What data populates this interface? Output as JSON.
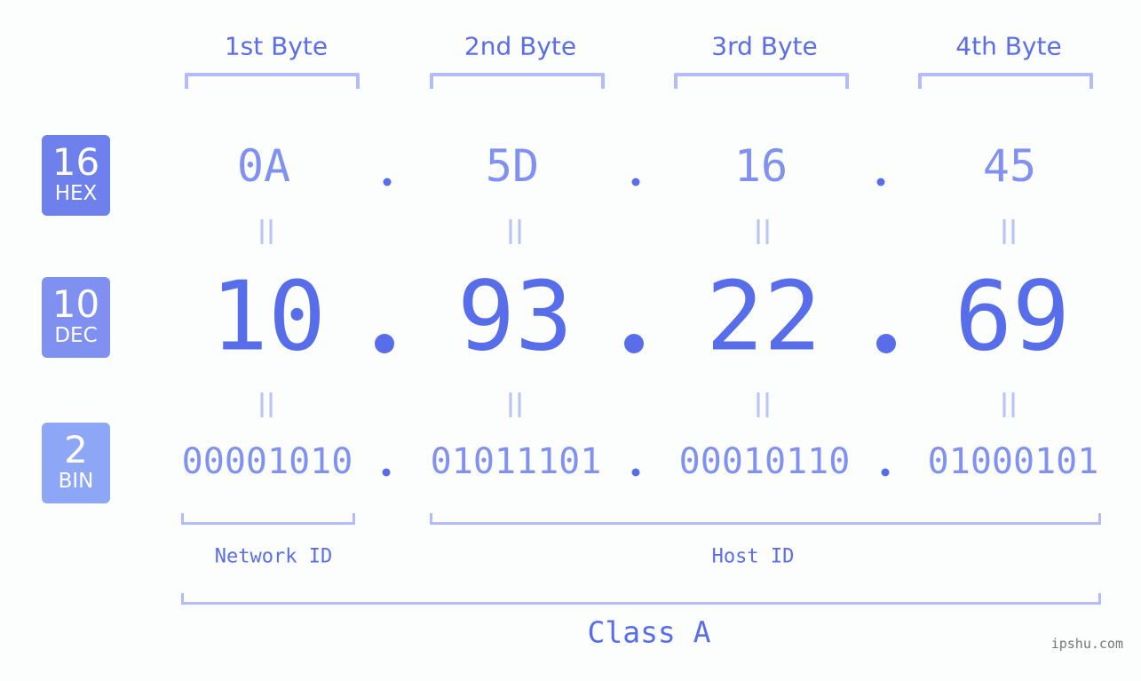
{
  "byte_headers": [
    "1st Byte",
    "2nd Byte",
    "3rd Byte",
    "4th Byte"
  ],
  "badges": {
    "hex": {
      "number": "16",
      "label": "HEX",
      "color": "#6e80ec"
    },
    "dec": {
      "number": "10",
      "label": "DEC",
      "color": "#7f90f0"
    },
    "bin": {
      "number": "2",
      "label": "BIN",
      "color": "#8ea6f6"
    }
  },
  "hex_octets": [
    "0A",
    "5D",
    "16",
    "45"
  ],
  "dec_octets": [
    "10",
    "93",
    "22",
    "69"
  ],
  "bin_octets": [
    "00001010",
    "01011101",
    "00010110",
    "01000101"
  ],
  "separator": ".",
  "network_label": "Network ID",
  "host_label": "Host ID",
  "class_label": "Class A",
  "watermark": "ipshu.com",
  "colors": {
    "accent": "#576de9",
    "light_accent": "#8191ef",
    "bracket": "#b3bcf8",
    "background": "#fcfdfd"
  }
}
